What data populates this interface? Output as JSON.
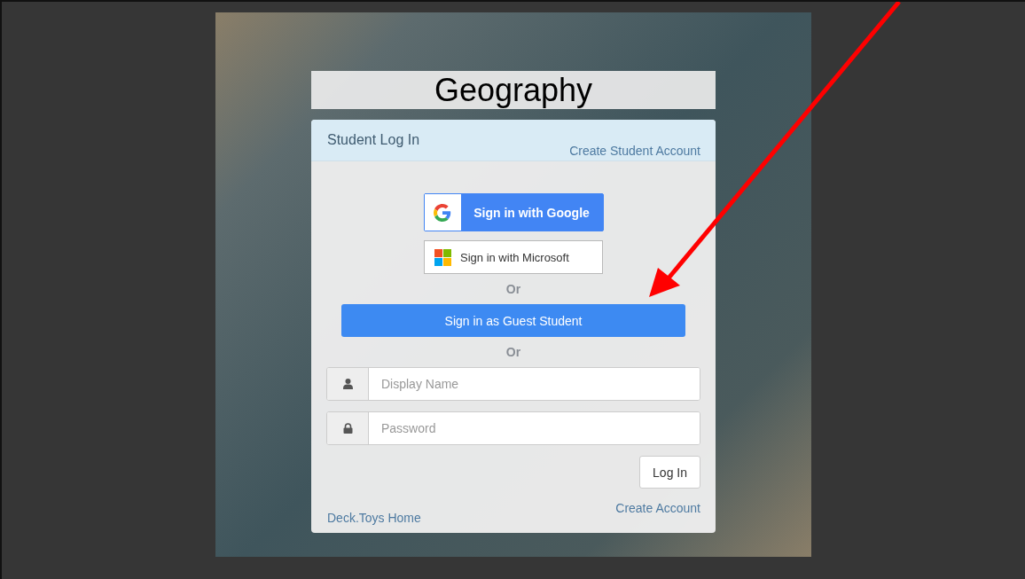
{
  "title": "Geography",
  "login": {
    "heading": "Student Log In",
    "create_student_account": "Create Student Account",
    "providers": [
      {
        "kind": "google",
        "label": "Sign in with Google"
      },
      {
        "kind": "microsoft",
        "label": "Sign in with Microsoft"
      }
    ],
    "separators": [
      "Or",
      "Or"
    ],
    "guest_button": "Sign in as Guest Student",
    "fields": [
      {
        "kind": "user",
        "placeholder": "Display Name"
      },
      {
        "kind": "password",
        "placeholder": "Password"
      }
    ],
    "login_button": "Log In",
    "create_account": "Create Account",
    "home_link": "Deck.Toys Home"
  }
}
